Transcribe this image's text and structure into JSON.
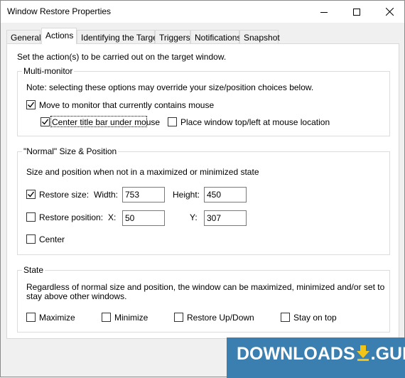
{
  "window": {
    "title": "Window Restore Properties"
  },
  "tabs": [
    {
      "label": "General"
    },
    {
      "label": "Actions"
    },
    {
      "label": "Identifying the Target"
    },
    {
      "label": "Triggers"
    },
    {
      "label": "Notifications"
    },
    {
      "label": "Snapshot"
    }
  ],
  "intro": "Set the action(s) to be carried out on the target window.",
  "multimonitor": {
    "legend": "Multi-monitor",
    "note": "Note: selecting these options may override your size/position choices below.",
    "move_to_monitor": {
      "label": "Move to monitor that currently contains mouse",
      "checked": true
    },
    "center_title": {
      "label": "Center title bar under mouse",
      "checked": true
    },
    "place_topleft": {
      "label": "Place window top/left at mouse location",
      "checked": false
    }
  },
  "size_position": {
    "legend": "\"Normal\" Size & Position",
    "desc": "Size and position when not in a maximized or minimized state",
    "restore_size": {
      "label": "Restore size:",
      "checked": true
    },
    "width_label": "Width:",
    "width_value": "753",
    "height_label": "Height:",
    "height_value": "450",
    "restore_position": {
      "label": "Restore position:",
      "checked": false
    },
    "x_label": "X:",
    "x_value": "50",
    "y_label": "Y:",
    "y_value": "307",
    "center": {
      "label": "Center",
      "checked": false
    }
  },
  "state": {
    "legend": "State",
    "desc": "Regardless of normal size and position, the window can be maximized, minimized and/or set to stay above other windows.",
    "maximize": {
      "label": "Maximize",
      "checked": false
    },
    "minimize": {
      "label": "Minimize",
      "checked": false
    },
    "restore_updown": {
      "label": "Restore Up/Down",
      "checked": false
    },
    "stay_on_top": {
      "label": "Stay on top",
      "checked": false
    }
  },
  "watermark": {
    "text": "DOWNLOADS",
    "suffix": ".GURU"
  },
  "colors": {
    "titlebar": "#ffffff",
    "watermark_bg": "#3a7fb0",
    "watermark_arrow": "#f0c419"
  }
}
